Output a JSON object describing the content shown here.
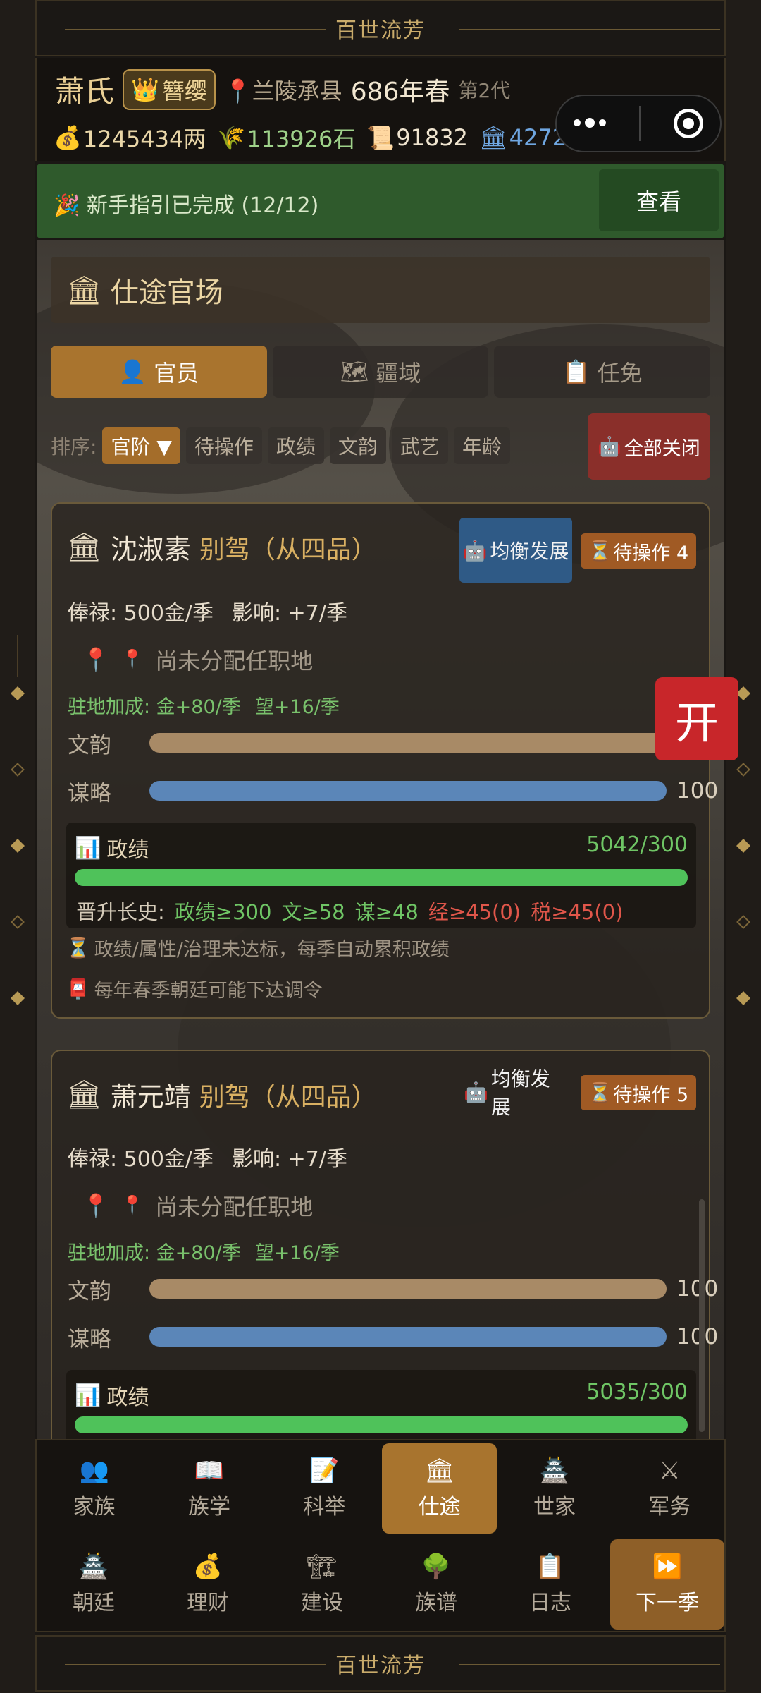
{
  "banner": {
    "text": "百世流芳"
  },
  "header": {
    "clan": "萧氏",
    "title_badge": "簪缨",
    "location": "兰陵承县",
    "year": "686年春",
    "generation": "第2代",
    "resources": {
      "silver": "1245434两",
      "grain": "113926石",
      "scrolls": "91832",
      "prestige": "42720"
    }
  },
  "guide": {
    "text": "新手指引已完成 (12/12)",
    "button": "查看"
  },
  "section": {
    "title": "仕途官场"
  },
  "tabs": [
    {
      "label": "官员",
      "active": true
    },
    {
      "label": "疆域",
      "active": false
    },
    {
      "label": "任免",
      "active": false
    }
  ],
  "sort": {
    "label": "排序:",
    "options": [
      "官阶 ▼",
      "待操作",
      "政绩",
      "文韵",
      "武艺",
      "年龄"
    ],
    "close_all": "全部关闭"
  },
  "open_button": "开",
  "officials": [
    {
      "name": "沈淑素",
      "rank": "别驾（从四品）",
      "strategy": "均衡发展",
      "pending": "待操作 4",
      "salary": "俸禄: 500金/季",
      "influence": "影响: +7/季",
      "post": "尚未分配任职地",
      "bonus_gold": "驻地加成: 金+80/季",
      "bonus_fame": "望+16/季",
      "attrs": [
        {
          "label": "文韵",
          "value": "",
          "fraction": 1.0
        },
        {
          "label": "谋略",
          "value": "100",
          "fraction": 1.0
        }
      ],
      "performance": {
        "label": "政绩",
        "value": "5042/300",
        "fraction": 1.0,
        "promotion_label": "晋升长史:",
        "requirements": [
          {
            "text": "政绩≥300",
            "met": true
          },
          {
            "text": "文≥58",
            "met": true
          },
          {
            "text": "谋≥48",
            "met": true
          },
          {
            "text": "经≥45(0)",
            "met": false
          },
          {
            "text": "税≥45(0)",
            "met": false
          }
        ]
      },
      "notes": [
        "政绩/属性/治理未达标，每季自动累积政绩",
        "每年春季朝廷可能下达调令"
      ]
    },
    {
      "name": "萧元靖",
      "rank": "别驾（从四品）",
      "strategy": "均衡发展",
      "pending": "待操作 5",
      "salary": "俸禄: 500金/季",
      "influence": "影响: +7/季",
      "post": "尚未分配任职地",
      "bonus_gold": "驻地加成: 金+80/季",
      "bonus_fame": "望+16/季",
      "attrs": [
        {
          "label": "文韵",
          "value": "100",
          "fraction": 1.0
        },
        {
          "label": "谋略",
          "value": "100",
          "fraction": 1.0
        }
      ],
      "performance": {
        "label": "政绩",
        "value": "5035/300",
        "fraction": 1.0
      }
    }
  ],
  "nav": {
    "row1": [
      {
        "label": "家族",
        "icon": "family-icon",
        "glyph": "👥"
      },
      {
        "label": "族学",
        "icon": "book-icon",
        "glyph": "📖"
      },
      {
        "label": "科举",
        "icon": "exam-icon",
        "glyph": "📝"
      },
      {
        "label": "仕途",
        "icon": "official-icon",
        "glyph": "🏛"
      },
      {
        "label": "世家",
        "icon": "castle-icon",
        "glyph": "🏯"
      },
      {
        "label": "军务",
        "icon": "swords-icon",
        "glyph": "⚔"
      }
    ],
    "row2": [
      {
        "label": "朝廷",
        "icon": "court-icon",
        "glyph": "🏯"
      },
      {
        "label": "理财",
        "icon": "money-icon",
        "glyph": "💰"
      },
      {
        "label": "建设",
        "icon": "crane-icon",
        "glyph": "🏗"
      },
      {
        "label": "族谱",
        "icon": "tree-icon",
        "glyph": "🌳"
      },
      {
        "label": "日志",
        "icon": "clipboard-icon",
        "glyph": "📋"
      },
      {
        "label": "下一季",
        "icon": "fast-forward-icon",
        "glyph": "⏩"
      }
    ],
    "active": "仕途"
  },
  "colors": {
    "accent": "#a8742e",
    "green": "#4fc25a",
    "blue": "#5b86b8",
    "tan": "#a88a66",
    "red": "#c8262a"
  }
}
